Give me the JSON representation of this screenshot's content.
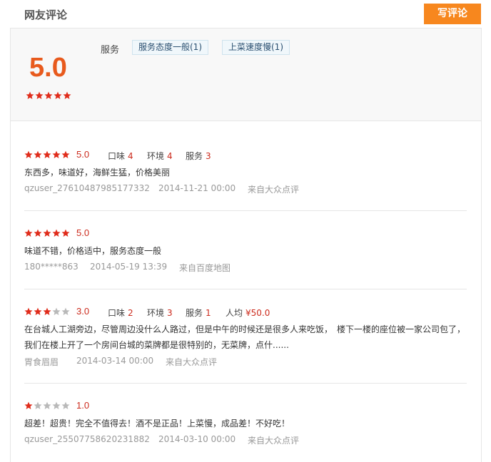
{
  "header": {
    "title": "网友评论",
    "write_label": "写评论"
  },
  "summary": {
    "score": "5.0",
    "score_stars": 5,
    "tag_label": "服务",
    "tags": [
      "服务态度一般(1)",
      "上菜速度慢(1)"
    ]
  },
  "colors": {
    "accent": "#f7871e",
    "score": "#e85a1d",
    "star_on": "#e02c1b",
    "star_off": "#b9b9b9"
  },
  "reviews": [
    {
      "stars": 5,
      "score": "5.0",
      "sub": [
        {
          "k": "口味",
          "v": "4"
        },
        {
          "k": "环境",
          "v": "4"
        },
        {
          "k": "服务",
          "v": "3"
        }
      ],
      "content": "东西多，味道好，海鲜生猛，价格美丽",
      "user": "qzuser_27610487985177332",
      "date": "2014-11-21 00:00",
      "source": "来自大众点评"
    },
    {
      "stars": 5,
      "score": "5.0",
      "sub": [],
      "content": "味道不错，价格适中，服务态度一般",
      "user": "180*****863",
      "date": "2014-05-19 13:39",
      "source": "来自百度地图"
    },
    {
      "stars": 3,
      "score": "3.0",
      "sub": [
        {
          "k": "口味",
          "v": "2"
        },
        {
          "k": "环境",
          "v": "3"
        },
        {
          "k": "服务",
          "v": "1"
        },
        {
          "k": "人均",
          "v": "¥50.0"
        }
      ],
      "content": "在台城人工湖旁边，尽管周边没什么人路过，但是中午的时候还是很多人来吃饭，　楼下一楼的座位被一家公司包了，我们在楼上开了一个房间台城的菜牌都是很特别的，无菜牌，点什......",
      "user": "胃食眉眉",
      "date": "2014-03-14 00:00",
      "source": "来自大众点评"
    },
    {
      "stars": 1,
      "score": "1.0",
      "sub": [],
      "content": "超差！超贵！完全不值得去！酒不是正品！上菜慢，成品差！不好吃！",
      "user": "qzuser_25507758620231882",
      "date": "2014-03-10 00:00",
      "source": "来自大众点评"
    }
  ]
}
